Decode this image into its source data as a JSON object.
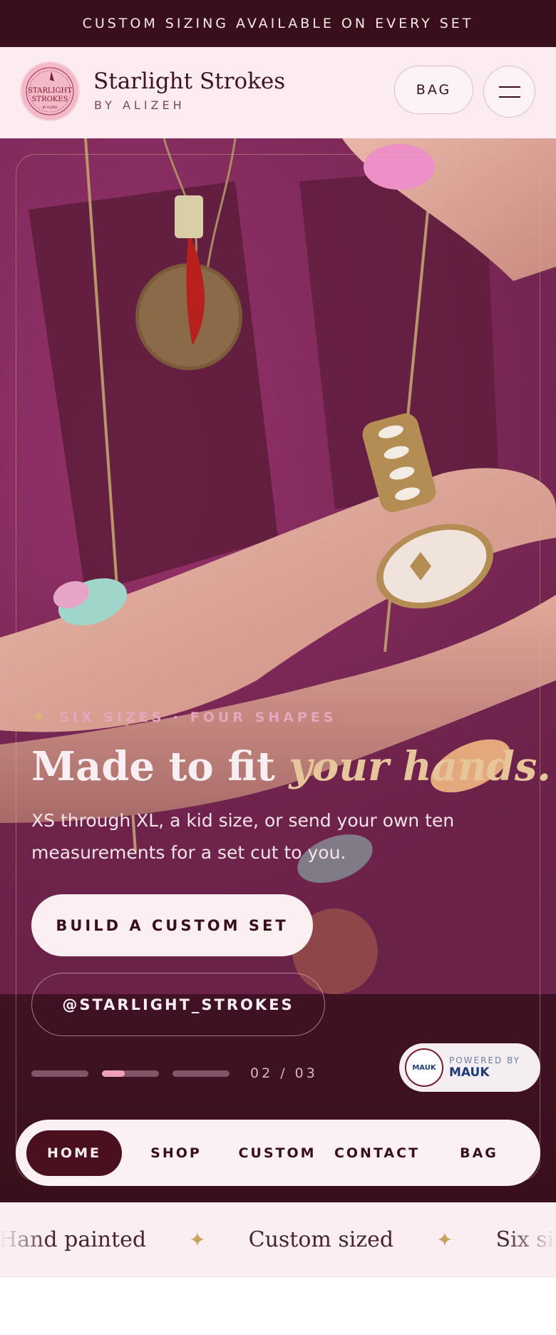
{
  "announcement": {
    "text": "CUSTOM SIZING AVAILABLE ON EVERY SET"
  },
  "header": {
    "logo_text": "Starlight Strokes",
    "brand_name": "Starlight Strokes",
    "brand_sub": "BY ALIZEH",
    "bag_label": "BAG",
    "menu_icon": "hamburger-icon"
  },
  "hero": {
    "eyebrow": "SIX SIZES · FOUR SHAPES",
    "eyebrow_icon": "sparkle-icon",
    "headline_plain": "Made to fit ",
    "headline_accent": "your hands.",
    "subcopy": "XS through XL, a kid size, or send your own ten measurements for a set cut to you.",
    "cta_primary": "BUILD A CUSTOM SET",
    "cta_secondary": "@STARLIGHT_STROKES",
    "slides": [
      {
        "progress": 0.0
      },
      {
        "progress": 0.4
      },
      {
        "progress": 0.0
      }
    ],
    "counter": "02 / 03"
  },
  "powered": {
    "label": "POWERED BY",
    "name": "MAUK",
    "badge": "MAUK"
  },
  "nav": {
    "items": [
      {
        "label": "HOME",
        "active": true
      },
      {
        "label": "SHOP",
        "active": false
      },
      {
        "label": "CUSTOM",
        "active": false
      },
      {
        "label": "CONTACT",
        "active": false
      },
      {
        "label": "BAG",
        "active": false
      }
    ]
  },
  "marquee": {
    "items": [
      "Hand painted",
      "Custom sized",
      "Six sizes"
    ],
    "separator": "✦"
  },
  "colors": {
    "announcement_bg": "#3a0f1c",
    "header_bg": "#fcecf1",
    "accent_gold": "#d8b479",
    "accent_pink": "#ee9fbb",
    "nav_active": "#4a1020"
  }
}
